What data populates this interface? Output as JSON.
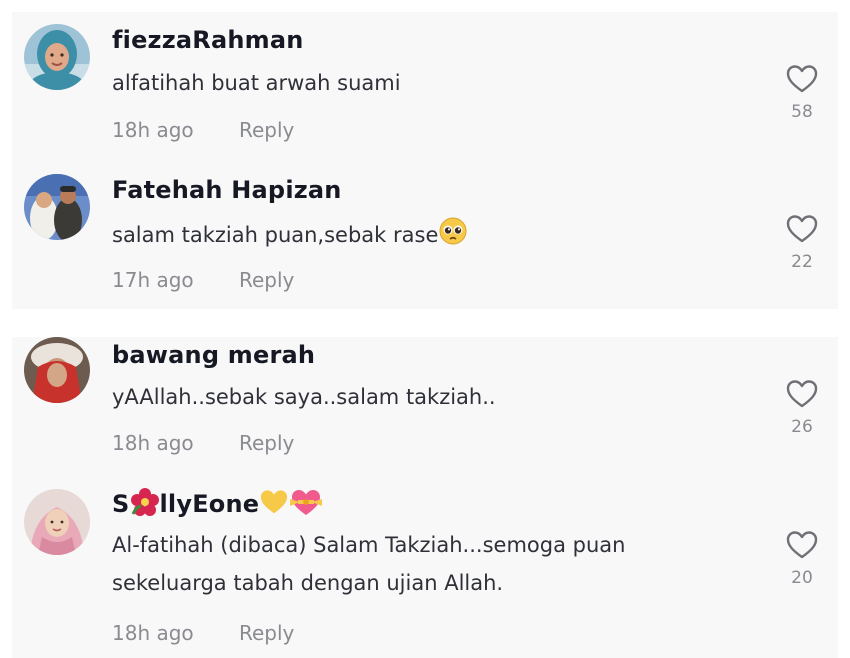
{
  "comments": [
    {
      "username": "fiezzaRahman",
      "text": "alfatihah buat arwah suami",
      "time": "18h ago",
      "reply": "Reply",
      "likes": "58",
      "like_icon": "heart-outline-icon"
    },
    {
      "username": "Fatehah Hapizan",
      "text": "salam takziah puan,sebak rase",
      "text_emoji": "pleading-face-emoji",
      "time": "17h ago",
      "reply": "Reply",
      "likes": "22",
      "like_icon": "heart-outline-icon"
    },
    {
      "username": "bawang merah",
      "text": "yAAllah..sebak saya..salam takziah..",
      "time": "18h ago",
      "reply": "Reply",
      "likes": "26",
      "like_icon": "heart-outline-icon"
    },
    {
      "username_prefix": "S",
      "username_emoji": "hibiscus-emoji",
      "username_suffix": "llyEone",
      "username_trailing_emojis": [
        "yellow-heart-emoji",
        "heart-with-ribbon-emoji"
      ],
      "text_line1": "Al-fatihah (dibaca) Salam Takziah...semoga puan",
      "text_line2": "sekeluarga tabah dengan ujian Allah.",
      "time": "18h ago",
      "reply": "Reply",
      "likes": "20",
      "like_icon": "heart-outline-icon"
    }
  ],
  "colors": {
    "panel_bg": "#f8f8f8",
    "username": "#161823",
    "text": "#2f3038",
    "meta": "#8a8b91"
  }
}
